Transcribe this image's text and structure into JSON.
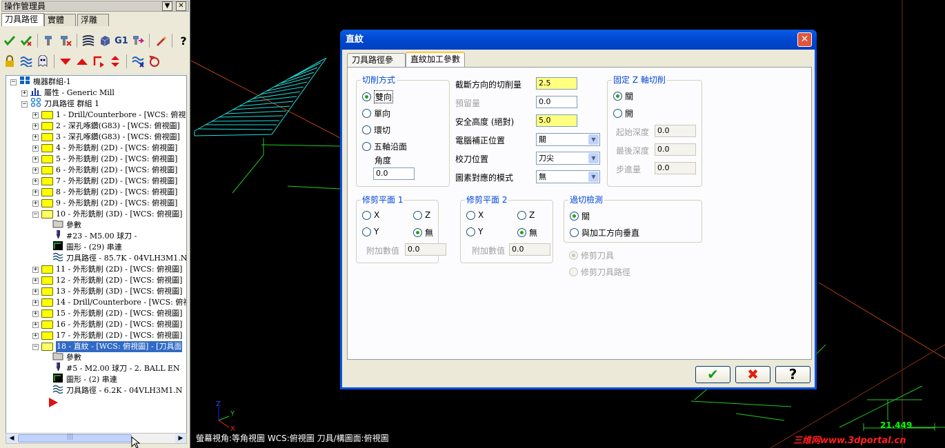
{
  "panel": {
    "title": "操作管理員",
    "pin_glyph": "▼",
    "close_glyph": "✕",
    "tabs": [
      {
        "label": "刀具路徑"
      },
      {
        "label": "實體"
      },
      {
        "label": "浮雕"
      }
    ],
    "toolbar_row1_icons": [
      "select-all-check-icon",
      "regen-check-icon",
      "tool-select-icon",
      "tool-deselect-icon",
      "toolpath-icon",
      "solid-icon",
      "g1-icon",
      "post-icon",
      "edit-icon",
      "help-icon"
    ],
    "g1_label": "G1",
    "help_glyph": "?",
    "toolbar_row2_icons": [
      "lock-icon",
      "wave-icon",
      "ghost-icon",
      "move-down-icon",
      "move-up-icon",
      "insert-arrow-icon",
      "move-updown-icon",
      "toolpath-display-icon",
      "rotate-icon"
    ],
    "tree": [
      {
        "indent": 0,
        "exp": "−",
        "icon": "machine",
        "text": "機器群組-1"
      },
      {
        "indent": 1,
        "exp": "+",
        "icon": "props",
        "text": "屬性 - Generic Mill"
      },
      {
        "indent": 1,
        "exp": "−",
        "icon": "group",
        "text": "刀具路徑 群組 1"
      },
      {
        "indent": 2,
        "exp": "+",
        "icon": "folder",
        "text": "1 - Drill/Counterbore - [WCS: 俯視圖"
      },
      {
        "indent": 2,
        "exp": "+",
        "icon": "folder",
        "text": "2 - 深孔啄鑽(G83) - [WCS: 俯視圖]"
      },
      {
        "indent": 2,
        "exp": "+",
        "icon": "folder",
        "text": "3 - 深孔啄鑽(G83) - [WCS: 俯視圖]"
      },
      {
        "indent": 2,
        "exp": "+",
        "icon": "folder",
        "text": "4 - 外形銑削 (2D) - [WCS: 俯視圖]"
      },
      {
        "indent": 2,
        "exp": "+",
        "icon": "folder",
        "text": "5 - 外形銑削 (2D) - [WCS: 俯視圖]"
      },
      {
        "indent": 2,
        "exp": "+",
        "icon": "folder",
        "text": "6 - 外形銑削 (2D) - [WCS: 俯視圖]"
      },
      {
        "indent": 2,
        "exp": "+",
        "icon": "folder",
        "text": "7 - 外形銑削 (2D) - [WCS: 俯視圖]"
      },
      {
        "indent": 2,
        "exp": "+",
        "icon": "folder",
        "text": "8 - 外形銑削 (2D) - [WCS: 俯視圖]"
      },
      {
        "indent": 2,
        "exp": "+",
        "icon": "folder",
        "text": "9 - 外形銑削 (2D) - [WCS: 俯視圖]"
      },
      {
        "indent": 2,
        "exp": "−",
        "icon": "folder-open",
        "text": "10 - 外形銑削 (3D) - [WCS: 俯視圖]"
      },
      {
        "indent": 3,
        "exp": "",
        "icon": "param",
        "text": "參數"
      },
      {
        "indent": 3,
        "exp": "",
        "icon": "tool",
        "text": "#23 - M5.00 球刀 -"
      },
      {
        "indent": 3,
        "exp": "",
        "icon": "geom",
        "text": "圖形 - (29) 串連"
      },
      {
        "indent": 3,
        "exp": "",
        "icon": "path",
        "text": "刀具路徑 - 85.7K - 04VLH3M1.N"
      },
      {
        "indent": 2,
        "exp": "+",
        "icon": "folder",
        "text": "11 - 外形銑削 (2D) - [WCS: 俯視圖]"
      },
      {
        "indent": 2,
        "exp": "+",
        "icon": "folder",
        "text": "12 - 外形銑削 (2D) - [WCS: 俯視圖]"
      },
      {
        "indent": 2,
        "exp": "+",
        "icon": "folder",
        "text": "13 - 外形銑削 (3D) - [WCS: 俯視圖]"
      },
      {
        "indent": 2,
        "exp": "+",
        "icon": "folder",
        "text": "14 - Drill/Counterbore - [WCS: 俯視圖"
      },
      {
        "indent": 2,
        "exp": "+",
        "icon": "folder",
        "text": "15 - 外形銑削 (2D) - [WCS: 俯視圖]"
      },
      {
        "indent": 2,
        "exp": "+",
        "icon": "folder",
        "text": "16 - 外形銑削 (2D) - [WCS: 俯視圖]"
      },
      {
        "indent": 2,
        "exp": "+",
        "icon": "folder",
        "text": "17 - 外形銑削 (2D) - [WCS: 俯視圖]"
      },
      {
        "indent": 2,
        "exp": "−",
        "icon": "folder-open",
        "text": "18 - 直紋 - [WCS: 俯視圖] - [刀具面",
        "selected": true
      },
      {
        "indent": 3,
        "exp": "",
        "icon": "param",
        "text": "參數"
      },
      {
        "indent": 3,
        "exp": "",
        "icon": "tool",
        "text": "#5 - M2.00 球刀 -    2. BALL EN"
      },
      {
        "indent": 3,
        "exp": "",
        "icon": "geom",
        "text": "圖形 - (2) 串連"
      },
      {
        "indent": 3,
        "exp": "",
        "icon": "path",
        "text": "刀具路徑 - 6.2K - 04VLH3M1.N"
      }
    ],
    "scroll_left": "◀",
    "scroll_right": "▶",
    "scroll_grip": "|||"
  },
  "viewport": {
    "status_text": "螢幕視角:等角視圖    WCS:俯視圖    刀具/構圖面:俯視圖",
    "scale_value": "21.449",
    "watermark": "三维网www.3dportal.cn",
    "axis_x": "X",
    "axis_y": "Y",
    "axis_z": "Z"
  },
  "dialog": {
    "title": "直紋",
    "close_glyph": "✕",
    "tabs": [
      {
        "label": "刀具路徑參數",
        "active": false
      },
      {
        "label": "直紋加工參數",
        "active": true
      }
    ],
    "cut_method": {
      "label": "切削方式",
      "options": [
        "雙向",
        "單向",
        "環切",
        "五軸沿面"
      ],
      "selected": "雙向",
      "angle_label": "角度",
      "angle_value": "0.0"
    },
    "params": [
      {
        "label": "截斷方向的切削量",
        "value": "2.5",
        "highlight": true,
        "disabled": false
      },
      {
        "label": "預留量",
        "value": "0.0",
        "highlight": false,
        "disabled": true
      },
      {
        "label": "安全高度 (絕對)",
        "value": "5.0",
        "highlight": true,
        "disabled": false
      }
    ],
    "selects": [
      {
        "label": "電腦補正位置",
        "value": "關"
      },
      {
        "label": "校刀位置",
        "value": "刀尖"
      },
      {
        "label": "圖素對應的模式",
        "value": "無"
      }
    ],
    "fixed_z": {
      "label": "固定 Z 軸切削",
      "options": [
        "關",
        "開"
      ],
      "selected": "關",
      "fields": [
        {
          "label": "起始深度",
          "value": "0.0"
        },
        {
          "label": "最後深度",
          "value": "0.0"
        },
        {
          "label": "步進量",
          "value": "0.0"
        }
      ]
    },
    "trim1": {
      "label": "修剪平面 1",
      "options": [
        "X",
        "Z",
        "Y",
        "無"
      ],
      "selected": "無",
      "extra_label": "附加數值",
      "extra_value": "0.0"
    },
    "trim2": {
      "label": "修剪平面 2",
      "options": [
        "X",
        "Z",
        "Y",
        "無"
      ],
      "selected": "無",
      "extra_label": "附加數值",
      "extra_value": "0.0"
    },
    "gouge": {
      "label": "過切檢測",
      "options": [
        "關",
        "與加工方向垂直"
      ],
      "selected": "關",
      "trim_options": [
        "修剪刀具",
        "修剪刀具路徑"
      ],
      "trim_selected": "修剪刀具"
    },
    "buttons": {
      "ok_glyph": "✔",
      "cancel_glyph": "✖",
      "help_glyph": "?",
      "ok_color": "#1a9a1a",
      "cancel_color": "#e02010"
    }
  }
}
